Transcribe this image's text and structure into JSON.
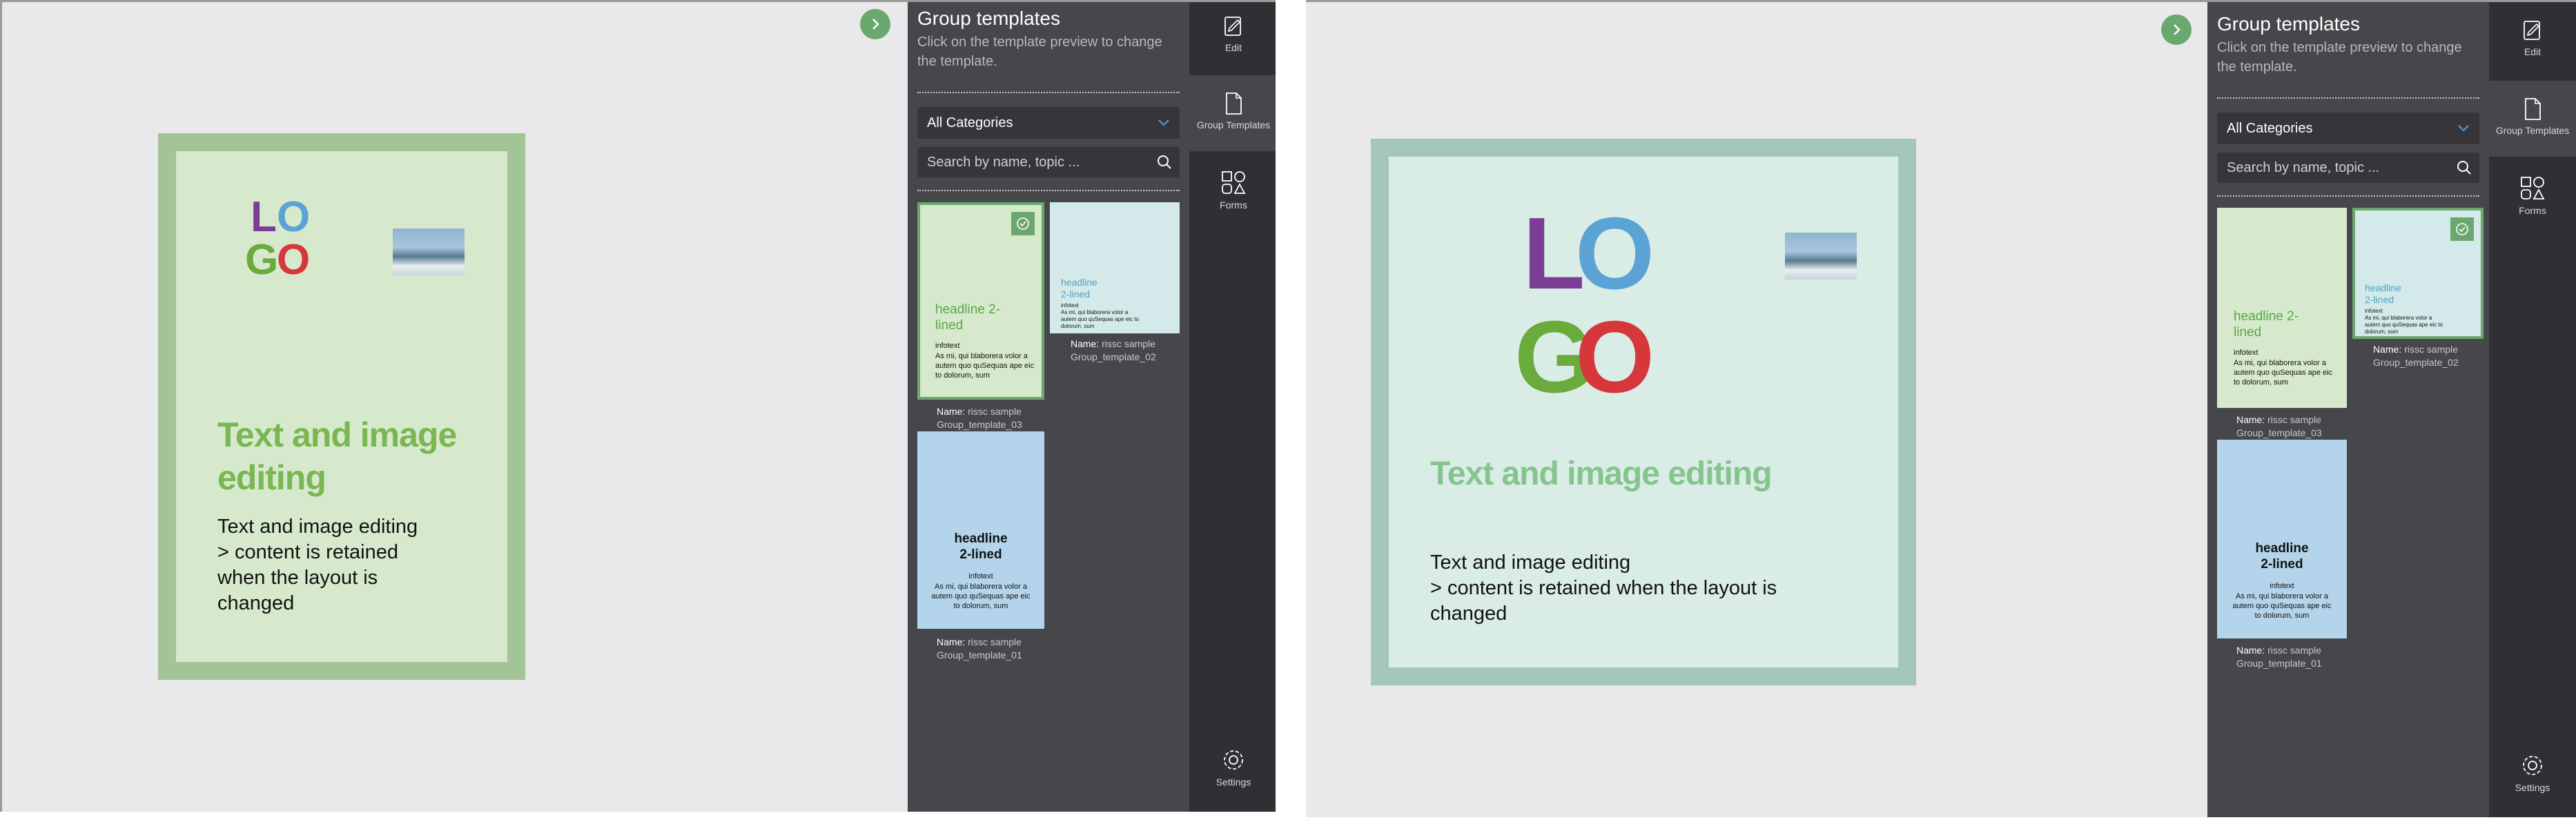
{
  "sidebar": {
    "title": "Group templates",
    "subtitle": "Click on the template preview to change the template.",
    "category_select": "All Categories",
    "search_placeholder": "Search by name, topic ...",
    "name_label": "Name:",
    "templates": [
      {
        "name_prefix": "rissc sample",
        "name": "Group_template_03",
        "headline": "headline 2-lined",
        "infotext": "infotext",
        "body": "As mi, qui blaborera volor a autem quo quSequas ape eic to dolorum, sum",
        "colors": {
          "bg": "#d6e9cc",
          "headline": "#5aa646"
        }
      },
      {
        "name_prefix": "rissc sample",
        "name": "Group_template_02",
        "headline": "headline 2-lined",
        "infotext": "infotext",
        "body": "As mi, qui blaborera volor a autem quo quSequas ape eic to dolorum, sum",
        "colors": {
          "bg": "#d4eaea",
          "headline": "#4aa3c4"
        }
      },
      {
        "name_prefix": "rissc sample",
        "name": "Group_template_01",
        "headline": "headline 2-lined",
        "infotext": "infotext",
        "body": "As mi, qui blaborera volor a autem quo quSequas ape eic to dolorum, sum",
        "colors": {
          "bg": "#b3d4ea",
          "headline": "#111111"
        }
      }
    ]
  },
  "rail": {
    "edit": "Edit",
    "group_templates": "Group Templates",
    "forms": "Forms",
    "settings": "Settings"
  },
  "left_document": {
    "logo_letters": [
      "L",
      "O",
      "G",
      "O"
    ],
    "heading": "Text and image editing",
    "body_line1": "Text and image editing",
    "body_line2": "> content is retained when the layout is changed",
    "colors": {
      "frame": "#a3c496",
      "page": "#d6e9cc",
      "heading": "#7ab651"
    }
  },
  "right_document": {
    "logo_letters": [
      "L",
      "O",
      "G",
      "O"
    ],
    "heading": "Text and image editing",
    "body_line1": "Text and image editing",
    "body_line2": "> content is retained when the layout is changed",
    "colors": {
      "frame": "#a5c6bc",
      "page": "#d9ece5",
      "heading": "#86c48e"
    }
  },
  "colors": {
    "logo_l": "#7b3d94",
    "logo_o1": "#5aa3d4",
    "logo_g": "#6aab3c",
    "logo_o2": "#d5373b",
    "selected_border": "#6aa86f",
    "check_badge": "#6aa86f"
  }
}
